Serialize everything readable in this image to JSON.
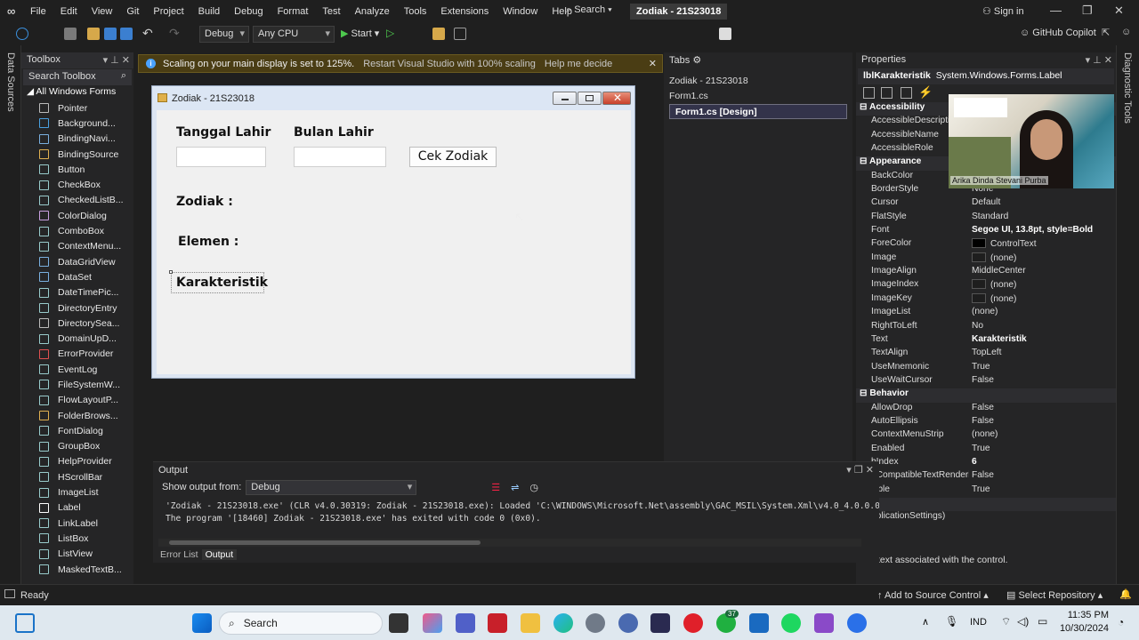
{
  "app": {
    "menu": [
      "File",
      "Edit",
      "View",
      "Git",
      "Project",
      "Build",
      "Debug",
      "Format",
      "Test",
      "Analyze",
      "Tools",
      "Extensions",
      "Window",
      "Help"
    ],
    "search_label": "Search",
    "solution_title": "Zodiak - 21S23018",
    "signin": "Sign in",
    "github_copilot": "GitHub Copilot"
  },
  "toolbar": {
    "config": "Debug",
    "platform": "Any CPU",
    "start": "Start"
  },
  "left_strip": {
    "label": "Data Sources"
  },
  "right_strip": {
    "label": "Diagnostic Tools"
  },
  "toolbox": {
    "title": "Toolbox",
    "search_placeholder": "Search Toolbox",
    "group": "All Windows Forms",
    "items": [
      "Pointer",
      "Background...",
      "BindingNavi...",
      "BindingSource",
      "Button",
      "CheckBox",
      "CheckedListB...",
      "ColorDialog",
      "ComboBox",
      "ContextMenu...",
      "DataGridView",
      "DataSet",
      "DateTimePic...",
      "DirectoryEntry",
      "DirectorySea...",
      "DomainUpD...",
      "ErrorProvider",
      "EventLog",
      "FileSystemW...",
      "FlowLayoutP...",
      "FolderBrows...",
      "FontDialog",
      "GroupBox",
      "HelpProvider",
      "HScrollBar",
      "ImageList",
      "Label",
      "LinkLabel",
      "ListBox",
      "ListView",
      "MaskedTextB..."
    ]
  },
  "infobar": {
    "message": "Scaling on your main display is set to 125%.",
    "restart_link": "Restart Visual Studio with 100% scaling",
    "help_link": "Help me decide"
  },
  "form": {
    "title": "Zodiak - 21S23018",
    "label_tanggal": "Tanggal Lahir",
    "label_bulan": "Bulan Lahir",
    "button_cek": "Cek Zodiak",
    "label_zodiak": "Zodiak :",
    "label_elemen": "Elemen :",
    "label_karakteristik": "Karakteristik"
  },
  "tabs": {
    "title": "Tabs",
    "project": "Zodiak - 21S23018",
    "items": [
      "Form1.cs",
      "Form1.cs [Design]"
    ]
  },
  "properties": {
    "title": "Properties",
    "object_name": "lblKarakteristik",
    "object_type": "System.Windows.Forms.Label",
    "description": "text associated with the control.",
    "rows": [
      {
        "n": "Accessibility",
        "v": "",
        "cat": true
      },
      {
        "n": "AccessibleDescriptio",
        "v": ""
      },
      {
        "n": "AccessibleName",
        "v": ""
      },
      {
        "n": "AccessibleRole",
        "v": ""
      },
      {
        "n": "Appearance",
        "v": "",
        "cat": true
      },
      {
        "n": "BackColor",
        "v": ""
      },
      {
        "n": "BorderStyle",
        "v": "None"
      },
      {
        "n": "Cursor",
        "v": "Default"
      },
      {
        "n": "FlatStyle",
        "v": "Standard"
      },
      {
        "n": "Font",
        "v": "Segoe UI, 13.8pt, style=Bold",
        "bold": true
      },
      {
        "n": "ForeColor",
        "v": "ControlText",
        "swatch": "#000000"
      },
      {
        "n": "Image",
        "v": "(none)",
        "swatch": "#1e1e1e"
      },
      {
        "n": "ImageAlign",
        "v": "MiddleCenter"
      },
      {
        "n": "ImageIndex",
        "v": "(none)",
        "swatch": "#1e1e1e"
      },
      {
        "n": "ImageKey",
        "v": "(none)",
        "swatch": "#1e1e1e"
      },
      {
        "n": "ImageList",
        "v": "(none)"
      },
      {
        "n": "RightToLeft",
        "v": "No"
      },
      {
        "n": "Text",
        "v": "Karakteristik",
        "bold": true
      },
      {
        "n": "TextAlign",
        "v": "TopLeft"
      },
      {
        "n": "UseMnemonic",
        "v": "True"
      },
      {
        "n": "UseWaitCursor",
        "v": "False"
      },
      {
        "n": "Behavior",
        "v": "",
        "cat": true
      },
      {
        "n": "AllowDrop",
        "v": "False"
      },
      {
        "n": "AutoEllipsis",
        "v": "False"
      },
      {
        "n": "ContextMenuStrip",
        "v": "(none)"
      },
      {
        "n": "Enabled",
        "v": "True"
      },
      {
        "n": "bIndex",
        "v": "6",
        "bold": true
      },
      {
        "n": "eCompatibleTextRenderir",
        "v": "False"
      },
      {
        "n": "sible",
        "v": "True"
      },
      {
        "n": "ta",
        "v": "",
        "cat": true
      },
      {
        "n": "pplicationSettings)",
        "v": ""
      }
    ]
  },
  "webcam": {
    "name": "Arika Dinda Stevani Purba"
  },
  "output": {
    "title": "Output",
    "show_from_label": "Show output from:",
    "source": "Debug",
    "lines": [
      "'Zodiak - 21S23018.exe' (CLR v4.0.30319: Zodiak - 21S23018.exe): Loaded 'C:\\WINDOWS\\Microsoft.Net\\assembly\\GAC_MSIL\\System.Xml\\v4.0_4.0.0.0__b77a5c5",
      "The program '[18460] Zodiak - 21S23018.exe' has exited with code 0 (0x0)."
    ],
    "tabs": [
      "Error List",
      "Output"
    ]
  },
  "status": {
    "ready": "Ready",
    "add_source": "Add to Source Control",
    "select_repo": "Select Repository"
  },
  "taskbar": {
    "search": "Search",
    "lang": "IND",
    "time": "11:35 PM",
    "date": "10/30/2024",
    "whatsapp_badge": "37"
  }
}
